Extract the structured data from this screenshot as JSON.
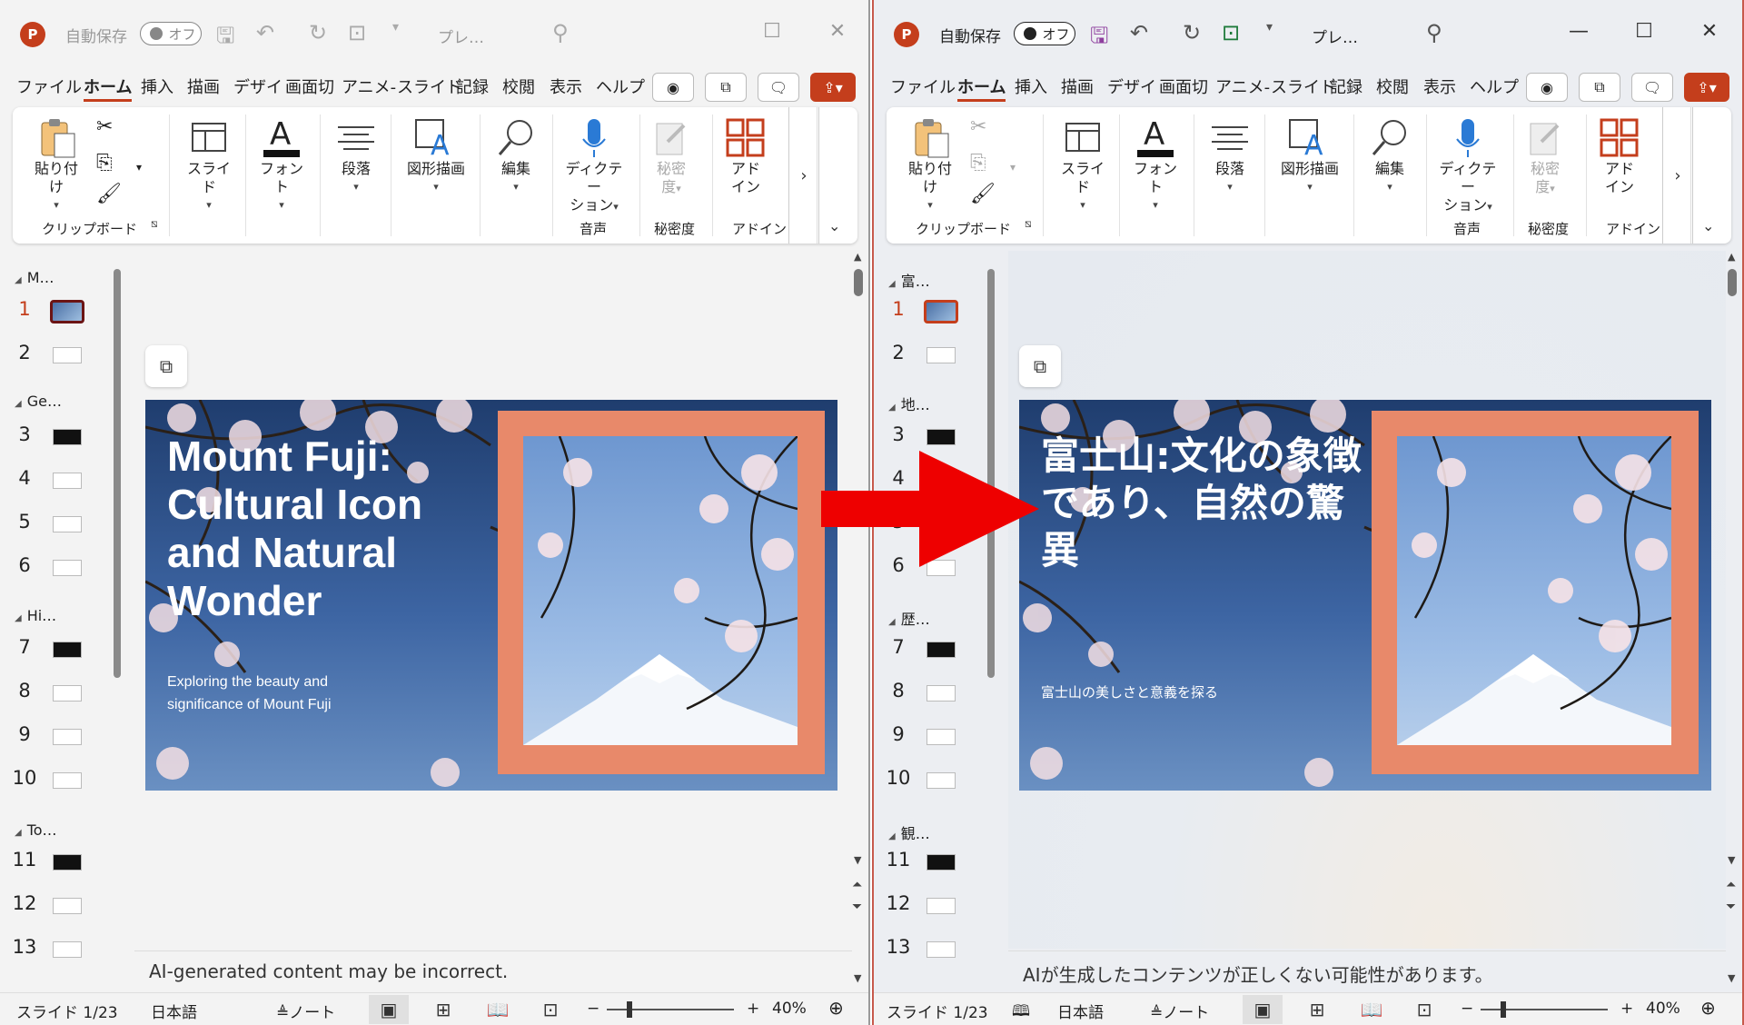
{
  "left": {
    "title_bar": {
      "autosave": "自動保存",
      "toggle": "オフ",
      "doc_title": "プレ…"
    },
    "menu": [
      "ファイル",
      "ホーム",
      "挿入",
      "描画",
      "デザイ",
      "画面切",
      "アニメ-",
      "スライド",
      "記録",
      "校閲",
      "表示",
      "ヘルプ"
    ],
    "ribbon": {
      "paste": "貼り付け",
      "clipboard": "クリップボード",
      "slide": "スライド",
      "font": "フォント",
      "paragraph": "段落",
      "drawing": "図形描画",
      "editing": "編集",
      "dictate_1": "ディクテー",
      "dictate_2": "ション",
      "voice": "音声",
      "sensitivity_1": "秘密",
      "sensitivity_2": "度",
      "sensitivity_group": "秘密度",
      "addin_1": "アド",
      "addin_2": "イン",
      "addin_group": "アドイン"
    },
    "sections": [
      "M…",
      "Ge…",
      "Hi…",
      "To…"
    ],
    "slides": [
      "1",
      "2",
      "3",
      "4",
      "5",
      "6",
      "7",
      "8",
      "9",
      "10",
      "11",
      "12",
      "13"
    ],
    "slide": {
      "title": "Mount Fuji: Cultural Icon and Natural Wonder",
      "subtitle": "Exploring the beauty and significance of Mount Fuji"
    },
    "notes": "AI-generated content may be incorrect.",
    "status": {
      "slide_counter": "スライド 1/23",
      "language": "日本語",
      "notes": "ノート",
      "zoom": "40%"
    }
  },
  "right": {
    "title_bar": {
      "autosave": "自動保存",
      "toggle": "オフ",
      "doc_title": "プレ…"
    },
    "menu": [
      "ファイル",
      "ホーム",
      "挿入",
      "描画",
      "デザイ",
      "画面切",
      "アニメ-",
      "スライド",
      "記録",
      "校閲",
      "表示",
      "ヘルプ"
    ],
    "ribbon": {
      "paste": "貼り付け",
      "clipboard": "クリップボード",
      "slide": "スライド",
      "font": "フォント",
      "paragraph": "段落",
      "drawing": "図形描画",
      "editing": "編集",
      "dictate_1": "ディクテー",
      "dictate_2": "ション",
      "voice": "音声",
      "sensitivity_1": "秘密",
      "sensitivity_2": "度",
      "sensitivity_group": "秘密度",
      "addin_1": "アド",
      "addin_2": "イン",
      "addin_group": "アドイン"
    },
    "sections": [
      "富…",
      "地…",
      "歴…",
      "観…"
    ],
    "slides": [
      "1",
      "2",
      "3",
      "4",
      "5",
      "6",
      "7",
      "8",
      "9",
      "10",
      "11",
      "12",
      "13"
    ],
    "slide": {
      "title": "富士山:文化の象徴であり、自然の驚異",
      "subtitle": "富士山の美しさと意義を探る"
    },
    "notes": "AIが生成したコンテンツが正しくない可能性があります。",
    "status": {
      "slide_counter": "スライド 1/23",
      "language": "日本語",
      "notes": "ノート",
      "zoom": "40%"
    }
  },
  "colors": {
    "accent": "#c43e1c",
    "frame": "#e8896a",
    "arrow": "#ee0000"
  }
}
